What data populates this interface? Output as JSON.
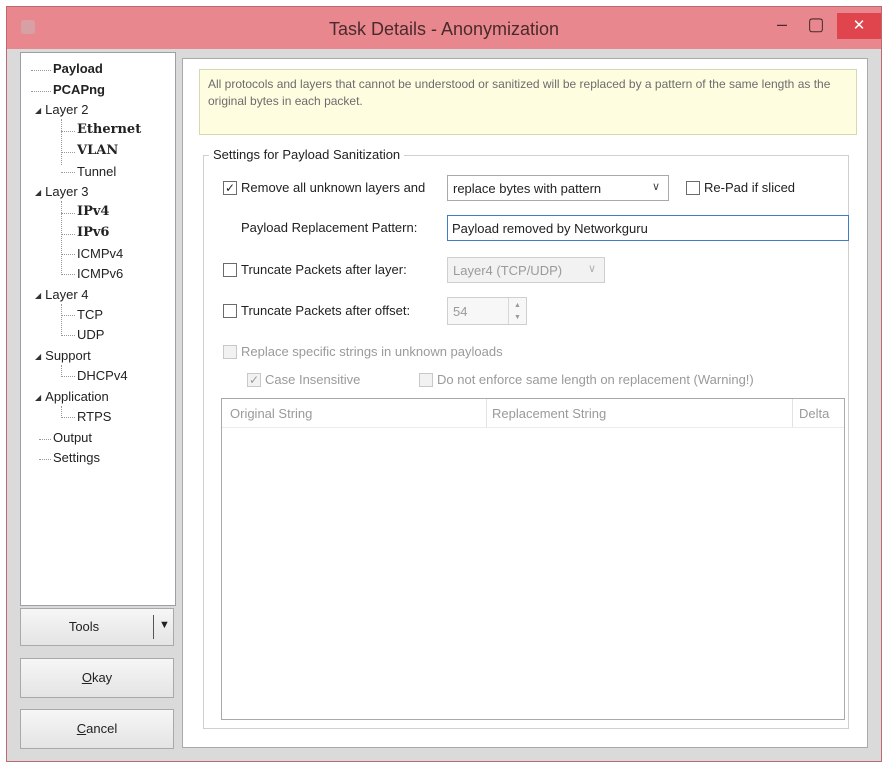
{
  "window": {
    "title": "Task Details - Anonymization",
    "minimize_glyph": "–",
    "maximize_glyph": "▢",
    "close_glyph": "✕"
  },
  "tree": {
    "payload": "Payload",
    "pcapng": "PCAPng",
    "layer2": "Layer 2",
    "ethernet": "Ethernet",
    "vlan": "VLAN",
    "tunnel": "Tunnel",
    "layer3": "Layer 3",
    "ipv4": "IPv4",
    "ipv6": "IPv6",
    "icmpv4": "ICMPv4",
    "icmpv6": "ICMPv6",
    "layer4": "Layer 4",
    "tcp": "TCP",
    "udp": "UDP",
    "support": "Support",
    "dhcpv4": "DHCPv4",
    "application": "Application",
    "rtps": "RTPS",
    "output": "Output",
    "settings": "Settings",
    "expand_glyph": "◢"
  },
  "buttons": {
    "tools": "Tools",
    "okay_mnemonic": "O",
    "okay_rest": "kay",
    "cancel_mnemonic": "C",
    "cancel_rest": "ancel"
  },
  "info_text": "All protocols and layers that cannot be understood or sanitized will be replaced by a pattern of the same length as the original bytes in each packet.",
  "settings": {
    "group_title": "Settings for Payload Sanitization",
    "remove_unknown_label": "Remove all unknown layers and",
    "remove_unknown_checked": true,
    "replace_mode": "replace bytes with pattern",
    "repad_label": "Re-Pad if sliced",
    "repad_checked": false,
    "pattern_label": "Payload Replacement Pattern:",
    "pattern_value": "Payload removed by Networkguru",
    "truncate_layer_label": "Truncate Packets after layer:",
    "truncate_layer_checked": false,
    "truncate_layer_value": "Layer4 (TCP/UDP)",
    "truncate_offset_label": "Truncate Packets after offset:",
    "truncate_offset_checked": false,
    "truncate_offset_value": "54",
    "replace_strings_label": "Replace specific strings in unknown payloads",
    "case_insensitive_label": "Case Insensitive",
    "case_insensitive_checked": true,
    "no_enforce_label": "Do not enforce same length on replacement (Warning!)",
    "check_glyph": "✓",
    "combo_arrow": "∨",
    "spin_up": "▲",
    "spin_down": "▼"
  },
  "table": {
    "columns": [
      "Original String",
      "Replacement String",
      "Delta"
    ]
  }
}
